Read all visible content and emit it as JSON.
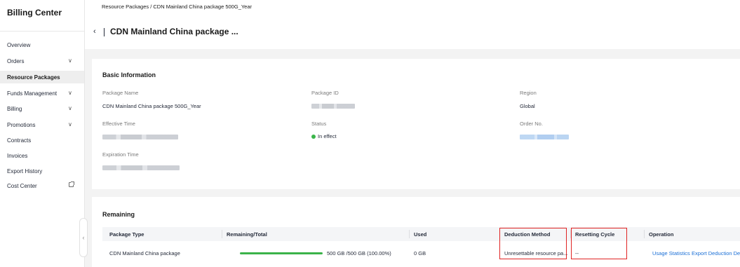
{
  "sidebar": {
    "title": "Billing Center",
    "items": [
      {
        "label": "Overview"
      },
      {
        "label": "Orders",
        "expand": "∨"
      },
      {
        "label": "Resource Packages"
      },
      {
        "label": "Funds Management",
        "expand": "∨"
      },
      {
        "label": "Billing",
        "expand": "∨"
      },
      {
        "label": "Promotions",
        "expand": "∨"
      },
      {
        "label": "Contracts"
      },
      {
        "label": "Invoices"
      },
      {
        "label": "Export History"
      },
      {
        "label": "Cost Center"
      }
    ],
    "collapse_glyph": "‹"
  },
  "header": {
    "breadcrumb": "Resource Packages / CDN Mainland China package 500G_Year",
    "back_glyph": "‹",
    "title": "CDN Mainland China package ..."
  },
  "basic_info": {
    "title": "Basic Information",
    "package_name_label": "Package Name",
    "package_name_value": "CDN Mainland China package 500G_Year",
    "package_id_label": "Package ID",
    "region_label": "Region",
    "region_value": "Global",
    "effective_time_label": "Effective Time",
    "status_label": "Status",
    "status_value": "In effect",
    "status_color": "#3ab54a",
    "order_no_label": "Order No.",
    "expiration_time_label": "Expiration Time"
  },
  "remaining": {
    "title": "Remaining",
    "columns": {
      "package_type": "Package Type",
      "remaining_total": "Remaining/Total",
      "used": "Used",
      "deduction_method": "Deduction Method",
      "resetting_cycle": "Resetting Cycle",
      "operation": "Operation"
    },
    "row": {
      "package_type": "CDN Mainland China package",
      "remaining_fraction": 1.0,
      "remaining_text": "500 GB /500 GB (100.00%)",
      "used": "0 GB",
      "deduction_method": "Unresettable resource pa...",
      "resetting_cycle": "--",
      "op_usage": "Usage Statistics",
      "op_export": "Export Deduction De"
    }
  },
  "colors": {
    "accent_link": "#1a6fd6",
    "progress": "#3bb34a",
    "highlight": "#e02424"
  }
}
